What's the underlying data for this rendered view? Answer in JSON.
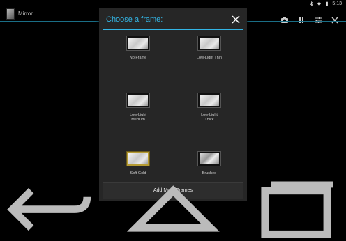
{
  "status_bar": {
    "time": "5:13",
    "icons": [
      "bluetooth-icon",
      "wifi-icon",
      "battery-icon"
    ]
  },
  "action_bar": {
    "title": "Mirror",
    "icons": [
      "camera-icon",
      "pause-icon",
      "settings-sliders-icon",
      "close-icon"
    ]
  },
  "dialog": {
    "title": "Choose a frame:",
    "frames": [
      {
        "label": "No Frame",
        "style": "plain"
      },
      {
        "label": "Low-Light Thin",
        "style": "plain"
      },
      {
        "label": "Low-Light\nMedium",
        "style": "plain"
      },
      {
        "label": "Low-Light\nThick",
        "style": "plain"
      },
      {
        "label": "Soft Gold",
        "style": "gold"
      },
      {
        "label": "Brushed",
        "style": "brushed"
      }
    ],
    "add_more_label": "Add More Frames"
  },
  "nav_bar": {
    "icons": [
      "back-icon",
      "home-icon",
      "recents-icon"
    ]
  },
  "colors": {
    "accent": "#33b5e5",
    "dialog_bg": "#262626"
  }
}
